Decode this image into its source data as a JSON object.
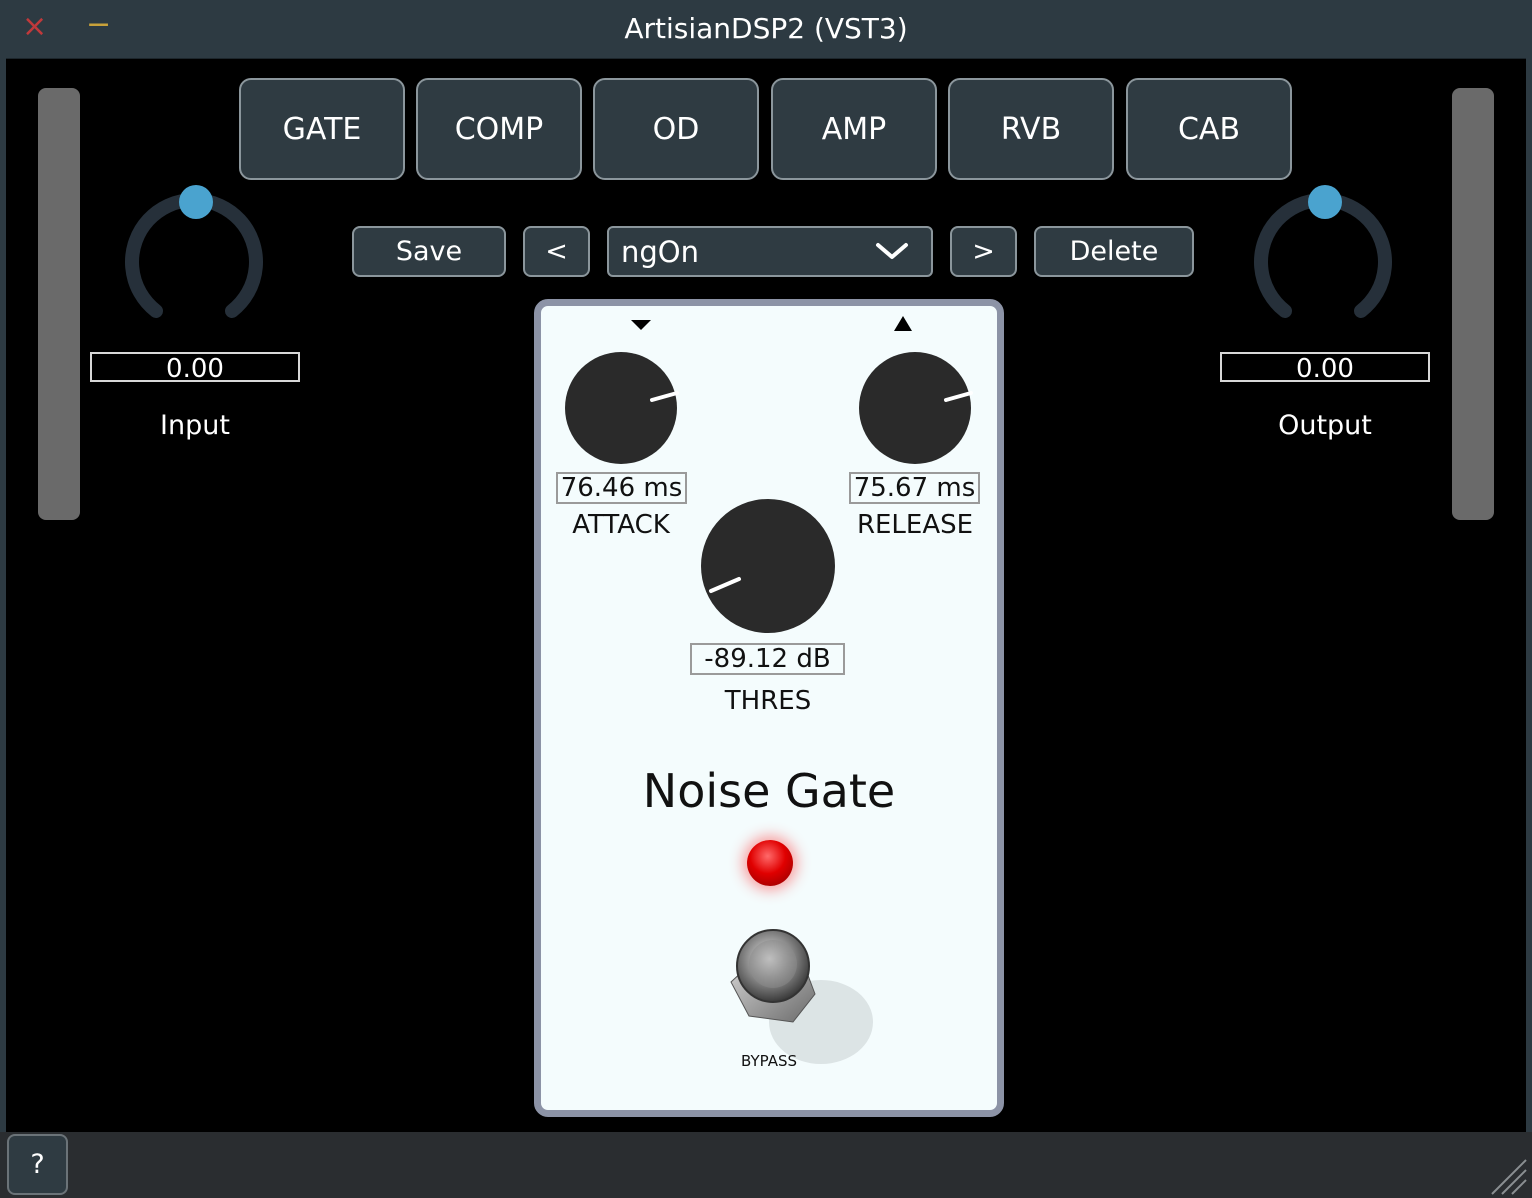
{
  "window": {
    "title": "ArtisianDSP2 (VST3)",
    "close_icon": "×",
    "minimize_icon": "−"
  },
  "tabs": [
    "GATE",
    "COMP",
    "OD",
    "AMP",
    "RVB",
    "CAB"
  ],
  "input": {
    "value": "0.00",
    "label": "Input",
    "level": 0.5
  },
  "output": {
    "value": "0.00",
    "label": "Output",
    "level": 0.5
  },
  "preset_bar": {
    "save_label": "Save",
    "prev_label": "<",
    "selected": "ngOn",
    "next_label": ">",
    "delete_label": "Delete"
  },
  "pedal": {
    "name": "Noise Gate",
    "bypass_label": "BYPASS",
    "attack": {
      "value": "76.46 ms",
      "label": "ATTACK"
    },
    "release": {
      "value": "75.67 ms",
      "label": "RELEASE"
    },
    "thres": {
      "value": "-89.12 dB",
      "label": "THRES"
    }
  },
  "footer": {
    "help_label": "?"
  },
  "colors": {
    "accent": "#4aa3cf",
    "panel": "#2f3b42",
    "led": "#e00000",
    "pedal_bg": "#f4fcfd"
  }
}
